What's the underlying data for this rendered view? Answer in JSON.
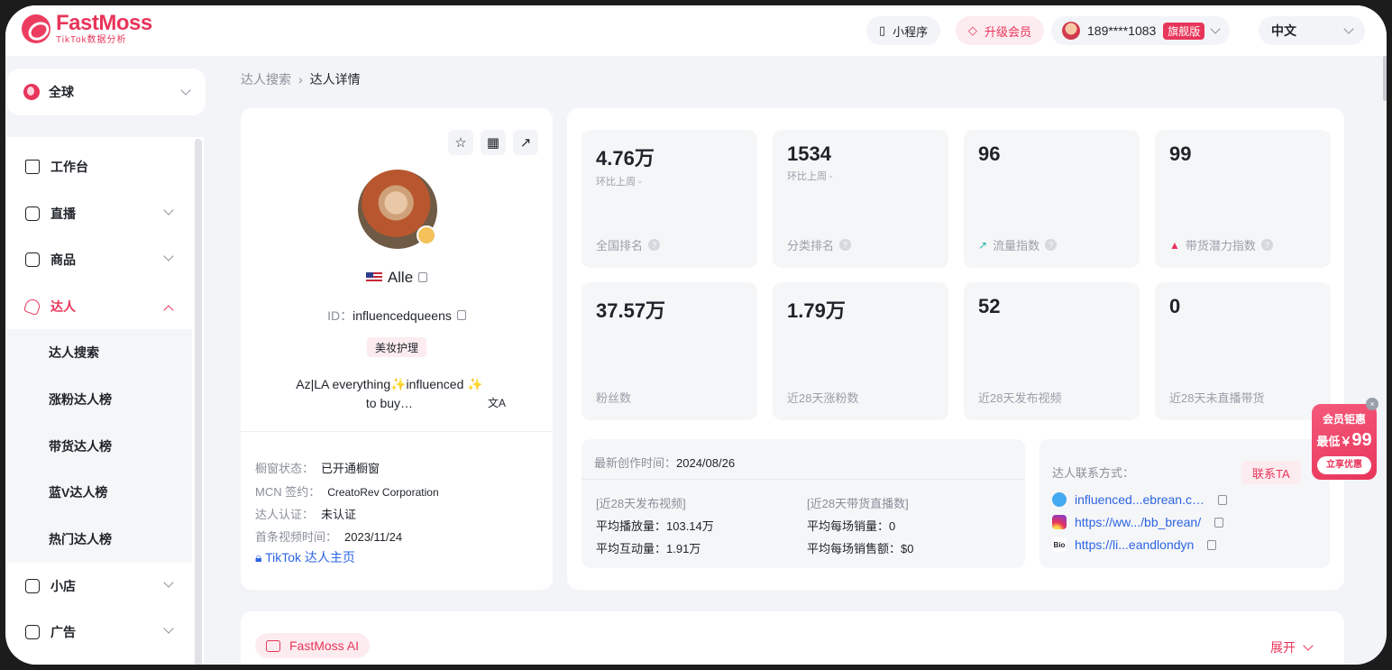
{
  "header": {
    "logo_name": "FastMoss",
    "logo_sub": "TikTok数据分析",
    "mini_program": "小程序",
    "upgrade": "升级会员",
    "user_phone": "189****1083",
    "user_tier": "旗舰版",
    "language": "中文"
  },
  "sidebar": {
    "region": "全球",
    "items": [
      {
        "label": "工作台",
        "icon": "home-icon"
      },
      {
        "label": "直播",
        "icon": "live-icon"
      },
      {
        "label": "商品",
        "icon": "product-icon"
      },
      {
        "label": "达人",
        "icon": "influencer-icon"
      },
      {
        "label": "小店",
        "icon": "shop-icon"
      },
      {
        "label": "广告",
        "icon": "ad-icon"
      }
    ],
    "sub_items": [
      "达人搜索",
      "涨粉达人榜",
      "带货达人榜",
      "蓝V达人榜",
      "热门达人榜"
    ]
  },
  "breadcrumb": {
    "parent": "达人搜索",
    "current": "达人详情"
  },
  "profile": {
    "name": "Alle",
    "id_label": "ID：",
    "id_value": "influencedqueens",
    "category": "美妆护理",
    "bio_line1": "Az|LA everything✨influenced ✨",
    "bio_line2": "to buy…",
    "window_label": "橱窗状态：",
    "window_value": "已开通橱窗",
    "mcn_label": "MCN 签约：",
    "mcn_value": "CreatoRev Corporation",
    "verify_label": "达人认证：",
    "verify_value": "未认证",
    "first_video_label": "首条视频时间：",
    "first_video_value": "2023/11/24",
    "tiktok_link": "TikTok 达人主页"
  },
  "stats": [
    {
      "value": "4.76万",
      "sub": "环比上周 -",
      "label": "全国排名",
      "icon": ""
    },
    {
      "value": "1534",
      "sub": "环比上周 -",
      "label": "分类排名",
      "icon": ""
    },
    {
      "value": "96",
      "sub": "",
      "label": "流量指数",
      "icon": "trend-icon"
    },
    {
      "value": "99",
      "sub": "",
      "label": "带货潜力指数",
      "icon": "fire-icon"
    },
    {
      "value": "37.57万",
      "sub": "",
      "label": "粉丝数",
      "icon": ""
    },
    {
      "value": "1.79万",
      "sub": "",
      "label": "近28天涨粉数",
      "icon": ""
    },
    {
      "value": "52",
      "sub": "",
      "label": "近28天发布视频",
      "icon": ""
    },
    {
      "value": "0",
      "sub": "",
      "label": "近28天未直播带货",
      "icon": ""
    }
  ],
  "activity": {
    "latest_label": "最新创作时间：",
    "latest_value": "2024/08/26",
    "video_head": "[近28天发布视频]",
    "live_head": "[近28天带货直播数]",
    "avg_play": "平均播放量：103.14万",
    "avg_interact": "平均互动量：1.91万",
    "avg_sales": "平均每场销量：0",
    "avg_revenue": "平均每场销售额：$0"
  },
  "contact": {
    "title": "达人联系方式：",
    "button": "联系TA",
    "email": "influenced...ebrean.c…",
    "instagram": "https://ww.../bb_brean/",
    "bio": "https://li...eandlondyn"
  },
  "promo": {
    "line1": "会员钜惠",
    "line2_prefix": "最低￥",
    "price": "99",
    "button": "立享优惠"
  },
  "ai": {
    "label": "FastMoss AI",
    "expand": "展开"
  }
}
